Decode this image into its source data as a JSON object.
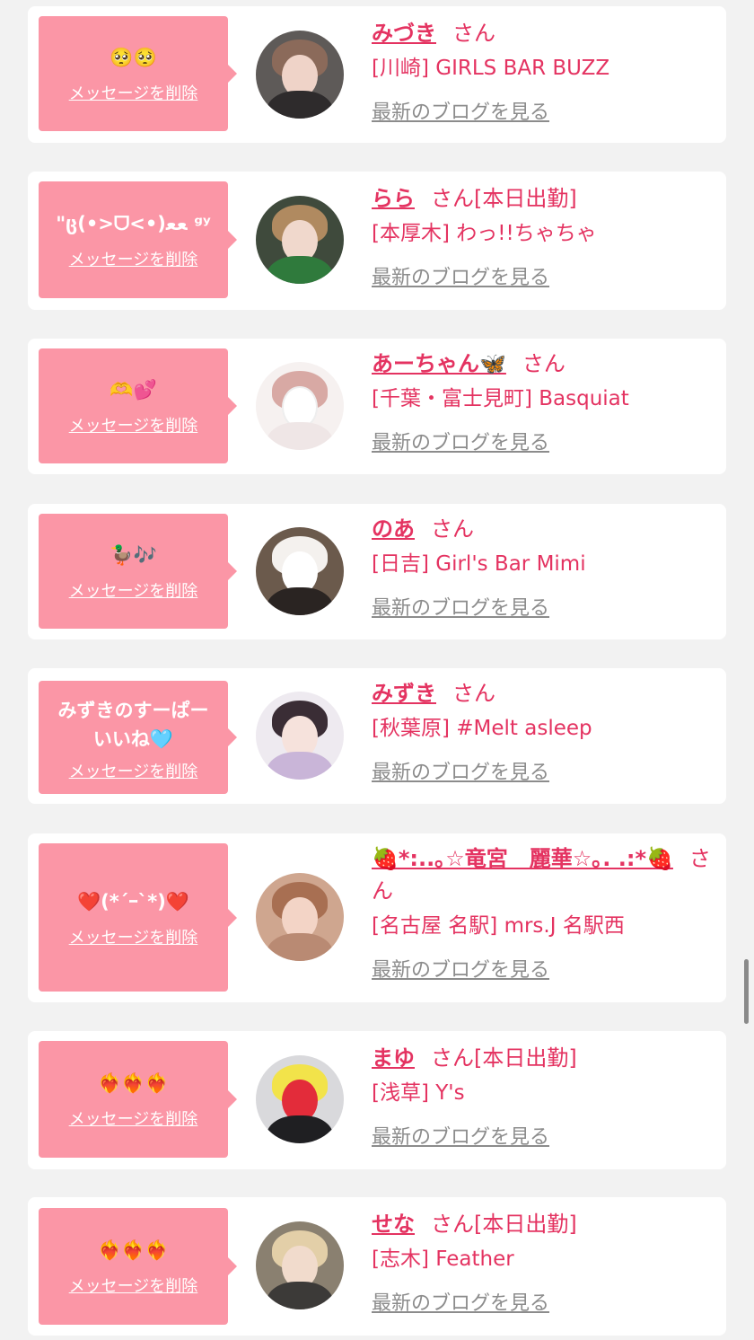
{
  "messages": [
    {
      "bubble_text": "🥺🥺",
      "delete_label": "メッセージを削除",
      "name": "みづき",
      "san": "さん",
      "status": "",
      "shop": "[川崎] GIRLS BAR BUZZ",
      "blog_label": "最新のブログを見る"
    },
    {
      "bubble_text": "\"ც(•>ᗜ<•)ﻌﻌ ᵍʸ",
      "delete_label": "メッセージを削除",
      "name": "らら",
      "san": "さん",
      "status": "[本日出勤]",
      "shop": "[本厚木] わっ!!ちゃちゃ",
      "blog_label": "最新のブログを見る"
    },
    {
      "bubble_text": "🫶💕",
      "delete_label": "メッセージを削除",
      "name": "あーちゃん🦋",
      "san": "さん",
      "status": "",
      "shop": "[千葉・富士見町] Basquiat",
      "blog_label": "最新のブログを見る"
    },
    {
      "bubble_text": "🦆🎶",
      "delete_label": "メッセージを削除",
      "name": "のあ",
      "san": "さん",
      "status": "",
      "shop": "[日吉] Girl's Bar Mimi",
      "blog_label": "最新のブログを見る"
    },
    {
      "bubble_text": "みずきのすーぱーいいね🩵",
      "delete_label": "メッセージを削除",
      "name": "みずき",
      "san": "さん",
      "status": "",
      "shop": "[秋葉原] #Melt asleep",
      "blog_label": "最新のブログを見る"
    },
    {
      "bubble_text": "❤️(*´ｰ`*)❤️",
      "delete_label": "メッセージを削除",
      "name": "🍓*:..｡☆竜宮　麗華☆｡. .:*🍓",
      "san": "さん",
      "status": "",
      "shop": "[名古屋 名駅] mrs.J 名駅西",
      "blog_label": "最新のブログを見る"
    },
    {
      "bubble_text": "❤️‍🔥❤️‍🔥❤️‍🔥",
      "delete_label": "メッセージを削除",
      "name": "まゆ",
      "san": "さん",
      "status": "[本日出勤]",
      "shop": "[浅草] Y's",
      "blog_label": "最新のブログを見る"
    },
    {
      "bubble_text": "❤️‍🔥❤️‍🔥❤️‍🔥",
      "delete_label": "メッセージを削除",
      "name": "せな",
      "san": "さん",
      "status": "[本日出勤]",
      "shop": "[志木] Feather",
      "blog_label": "最新のブログを見る"
    }
  ],
  "colors": {
    "accent": "#e43361",
    "bubble": "#fb96a6",
    "card": "#ffffff",
    "background": "#f2f2f2",
    "blog_link": "#8c8c8c"
  }
}
